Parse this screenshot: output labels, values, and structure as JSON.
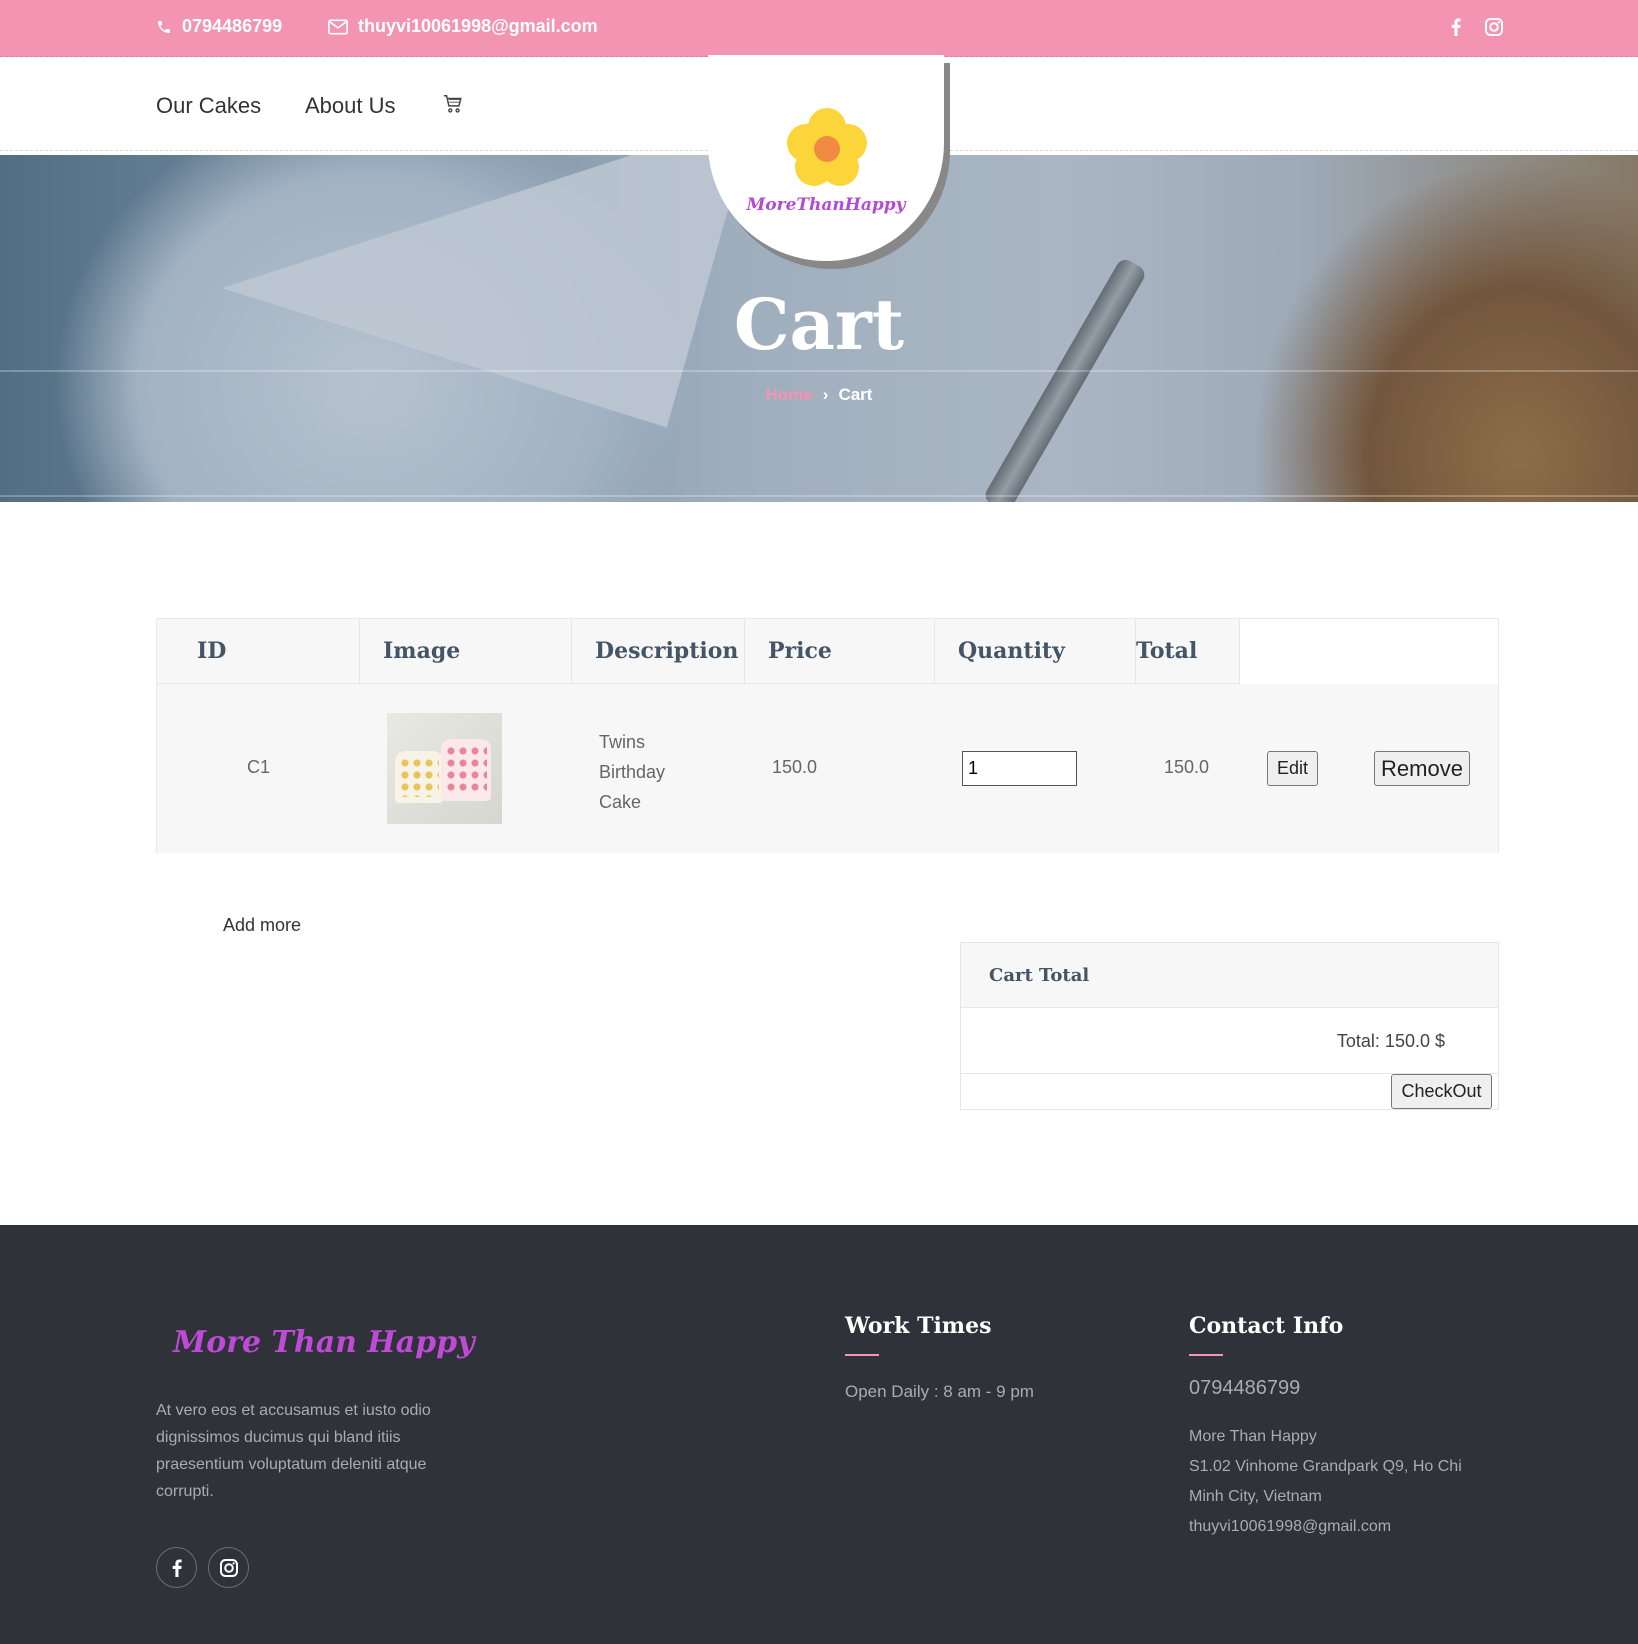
{
  "topbar": {
    "phone": "0794486799",
    "email": "thuyvi10061998@gmail.com",
    "social_icons": [
      "facebook-icon",
      "instagram-icon"
    ],
    "bg_color": "#f394b3"
  },
  "nav": {
    "items": [
      "Our Cakes",
      "About Us"
    ],
    "cart_icon": "cart-icon"
  },
  "logo": {
    "text": "MoreThanHappy"
  },
  "hero": {
    "title": "Cart",
    "breadcrumb": {
      "home": "Home",
      "separator": "›",
      "current": "Cart"
    }
  },
  "table": {
    "headers": [
      "ID",
      "Image",
      "Description",
      "Price",
      "Quantity",
      "Total"
    ],
    "rows": [
      {
        "id": "C1",
        "description": "Twins Birthday Cake",
        "price": "150.0",
        "quantity": "1",
        "total": "150.0",
        "edit_label": "Edit",
        "remove_label": "Remove"
      }
    ]
  },
  "add_more": "Add more",
  "cart_total": {
    "title": "Cart Total",
    "total_text": "Total: 150.0 $",
    "checkout_label": "CheckOut"
  },
  "footer": {
    "brand": "More Than Happy",
    "blurb": "At vero eos et accusamus et iusto odio dignissimos ducimus qui bland itiis praesentium voluptatum deleniti atque corrupti.",
    "work_title": "Work Times",
    "hours": "Open Daily : 8 am - 9 pm",
    "contact_title": "Contact Info",
    "phone": "0794486799",
    "address_lines": [
      "More Than Happy",
      "S1.02 Vinhome Grandpark Q9, Ho Chi Minh City, Vietnam",
      "thuyvi10061998@gmail.com"
    ],
    "accent_color": "#f394b3",
    "bg_color": "#2f3239"
  }
}
